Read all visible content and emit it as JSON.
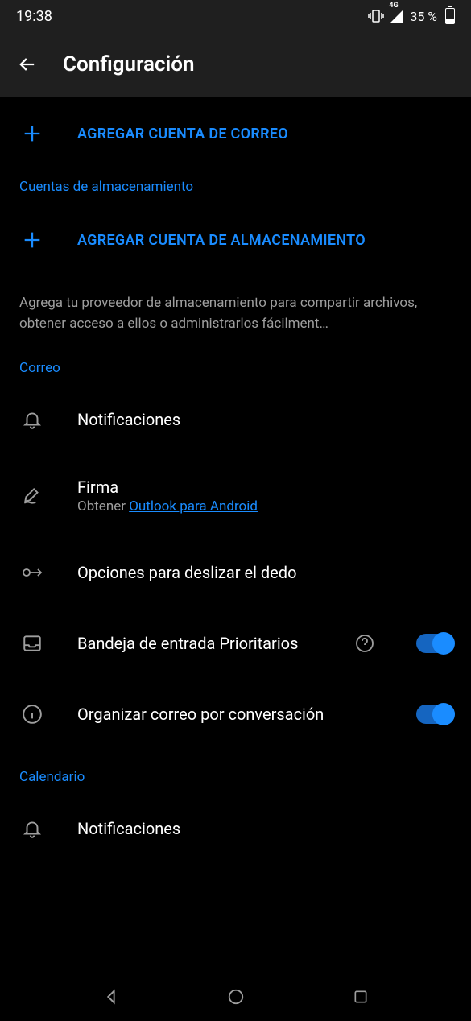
{
  "status": {
    "time": "19:38",
    "battery_pct": "35 %",
    "network_label": "4G"
  },
  "header": {
    "title": "Configuración"
  },
  "add_email": {
    "label": "AGREGAR CUENTA DE CORREO"
  },
  "sections": {
    "storage": "Cuentas de almacenamiento",
    "mail": "Correo",
    "calendar": "Calendario"
  },
  "add_storage": {
    "label": "AGREGAR CUENTA DE ALMACENAMIENTO",
    "desc": "Agrega tu proveedor de almacenamiento para compartir archivos, obtener acceso a ellos o administrarlos fácilment…"
  },
  "mail": {
    "notifications": "Notificaciones",
    "signature_title": "Firma",
    "signature_sub_prefix": "Obtener ",
    "signature_link": "Outlook para Android",
    "swipe": "Opciones para deslizar el dedo",
    "focused_inbox": "Bandeja de entrada Prioritarios",
    "organize": "Organizar correo por conversación",
    "focused_on": true,
    "organize_on": true
  },
  "calendar": {
    "notifications": "Notificaciones"
  }
}
